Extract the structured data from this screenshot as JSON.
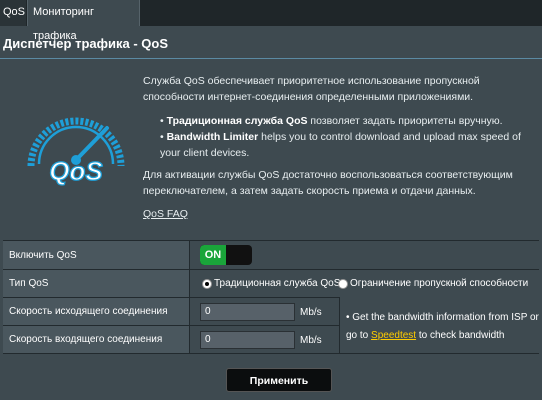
{
  "tabs": [
    {
      "label": "QoS"
    },
    {
      "label": "Мониторинг трафика"
    }
  ],
  "page_title": "Диспетчер трафика - QoS",
  "description": {
    "intro": "Служба QoS обеспечивает приоритетное использование пропускной способности интернет-соединения определенными приложениями.",
    "bullet1_bold": "Традиционная служба QoS",
    "bullet1_text": " позволяет задать приоритеты вручную.",
    "bullet2_bold": "Bandwidth Limiter",
    "bullet2_text": " helps you to control download and upload max speed of your client devices.",
    "activation": "Для активации службы QoS достаточно воспользоваться соответствующим переключателем, а затем задать скорость приема и отдачи данных.",
    "faq_link": "QoS FAQ"
  },
  "logo_text": "QoS",
  "form": {
    "enable_qos": {
      "label": "Включить QoS",
      "toggle_value": "ON"
    },
    "qos_type": {
      "label": "Тип QoS",
      "options": [
        "Традиционная служба QoS",
        "Ограничение пропускной способности"
      ],
      "selected": "Традиционная служба QoS"
    },
    "upload": {
      "label": "Скорость исходящего соединения",
      "value": "0",
      "unit": "Mb/s"
    },
    "download": {
      "label": "Скорость входящего соединения",
      "value": "0",
      "unit": "Mb/s"
    },
    "note": {
      "text_before": "Get the bandwidth information from ISP or go to ",
      "link": "Speedtest",
      "text_after": " to check bandwidth"
    }
  },
  "apply_button": "Применить",
  "colors": {
    "background": "#3e4a50",
    "toggle_on": "#1aa53a",
    "link_accent": "#ffcc00",
    "logo_blue": "#1e9fd8"
  }
}
